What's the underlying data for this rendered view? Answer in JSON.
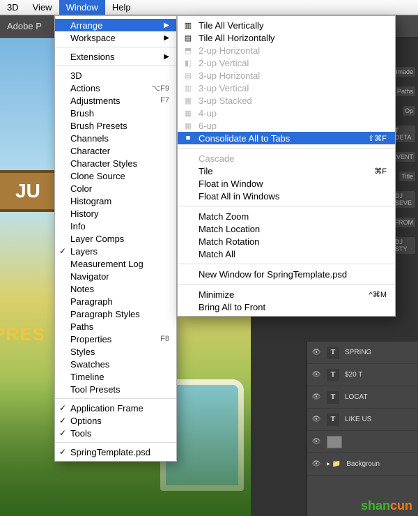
{
  "menubar": {
    "items": [
      "3D",
      "View",
      "Window",
      "Help"
    ],
    "selected": 2
  },
  "appbar": {
    "title": "Adobe P"
  },
  "window_menu": {
    "items": [
      {
        "label": "Arrange",
        "submenu": true,
        "selected": true
      },
      {
        "label": "Workspace",
        "submenu": true
      },
      {
        "sep": true
      },
      {
        "label": "Extensions",
        "submenu": true
      },
      {
        "sep": true
      },
      {
        "label": "3D"
      },
      {
        "label": "Actions",
        "shortcut": "⌥F9"
      },
      {
        "label": "Adjustments",
        "shortcut": "F7"
      },
      {
        "label": "Brush"
      },
      {
        "label": "Brush Presets"
      },
      {
        "label": "Channels"
      },
      {
        "label": "Character"
      },
      {
        "label": "Character Styles"
      },
      {
        "label": "Clone Source"
      },
      {
        "label": "Color"
      },
      {
        "label": "Histogram"
      },
      {
        "label": "History"
      },
      {
        "label": "Info"
      },
      {
        "label": "Layer Comps"
      },
      {
        "label": "Layers",
        "checked": true
      },
      {
        "label": "Measurement Log"
      },
      {
        "label": "Navigator"
      },
      {
        "label": "Notes"
      },
      {
        "label": "Paragraph"
      },
      {
        "label": "Paragraph Styles"
      },
      {
        "label": "Paths"
      },
      {
        "label": "Properties",
        "shortcut": "F8"
      },
      {
        "label": "Styles"
      },
      {
        "label": "Swatches"
      },
      {
        "label": "Timeline"
      },
      {
        "label": "Tool Presets"
      },
      {
        "sep": true
      },
      {
        "label": "Application Frame",
        "checked": true
      },
      {
        "label": "Options",
        "checked": true
      },
      {
        "label": "Tools",
        "checked": true
      },
      {
        "sep": true
      },
      {
        "label": "SpringTemplate.psd",
        "checked": true
      }
    ]
  },
  "arrange_submenu": {
    "items": [
      {
        "label": "Tile All Vertically",
        "icon": "▥"
      },
      {
        "label": "Tile All Horizontally",
        "icon": "▤"
      },
      {
        "label": "2-up Horizontal",
        "icon": "⬒",
        "disabled": true
      },
      {
        "label": "2-up Vertical",
        "icon": "◧",
        "disabled": true
      },
      {
        "label": "3-up Horizontal",
        "icon": "▤",
        "disabled": true
      },
      {
        "label": "3-up Vertical",
        "icon": "▥",
        "disabled": true
      },
      {
        "label": "3-up Stacked",
        "icon": "▦",
        "disabled": true
      },
      {
        "label": "4-up",
        "icon": "▦",
        "disabled": true
      },
      {
        "label": "6-up",
        "icon": "▦",
        "disabled": true
      },
      {
        "label": "Consolidate All to Tabs",
        "icon": "■",
        "selected": true,
        "shortcut": "⇧⌘F"
      },
      {
        "sep": true
      },
      {
        "label": "Cascade",
        "disabled": true
      },
      {
        "label": "Tile",
        "shortcut": "⌘F"
      },
      {
        "label": "Float in Window"
      },
      {
        "label": "Float All in Windows"
      },
      {
        "sep": true
      },
      {
        "label": "Match Zoom"
      },
      {
        "label": "Match Location"
      },
      {
        "label": "Match Rotation"
      },
      {
        "label": "Match All"
      },
      {
        "sep": true
      },
      {
        "label": "New Window for SpringTemplate.psd"
      },
      {
        "sep": true
      },
      {
        "label": "Minimize",
        "shortcut": "^⌘M"
      },
      {
        "label": "Bring All to Front"
      }
    ]
  },
  "right_labels": [
    "imade",
    "Paths",
    "Op",
    "T DETA",
    "SEVENT",
    "Title",
    "DJ SEVE",
    "FROM",
    "DJ STY"
  ],
  "layers": {
    "rows": [
      {
        "type": "T",
        "name": "SPRING"
      },
      {
        "type": "T",
        "name": "$20 T"
      },
      {
        "type": "T",
        "name": "LOCAT"
      },
      {
        "type": "T",
        "name": "LIKE US"
      },
      {
        "type": "thumb",
        "name": ""
      },
      {
        "type": "folder",
        "name": "Backgroun"
      }
    ]
  },
  "canvas": {
    "sign": "JU",
    "pres": "PRES"
  },
  "watermark": {
    "a": "shan",
    "b": "cun"
  }
}
